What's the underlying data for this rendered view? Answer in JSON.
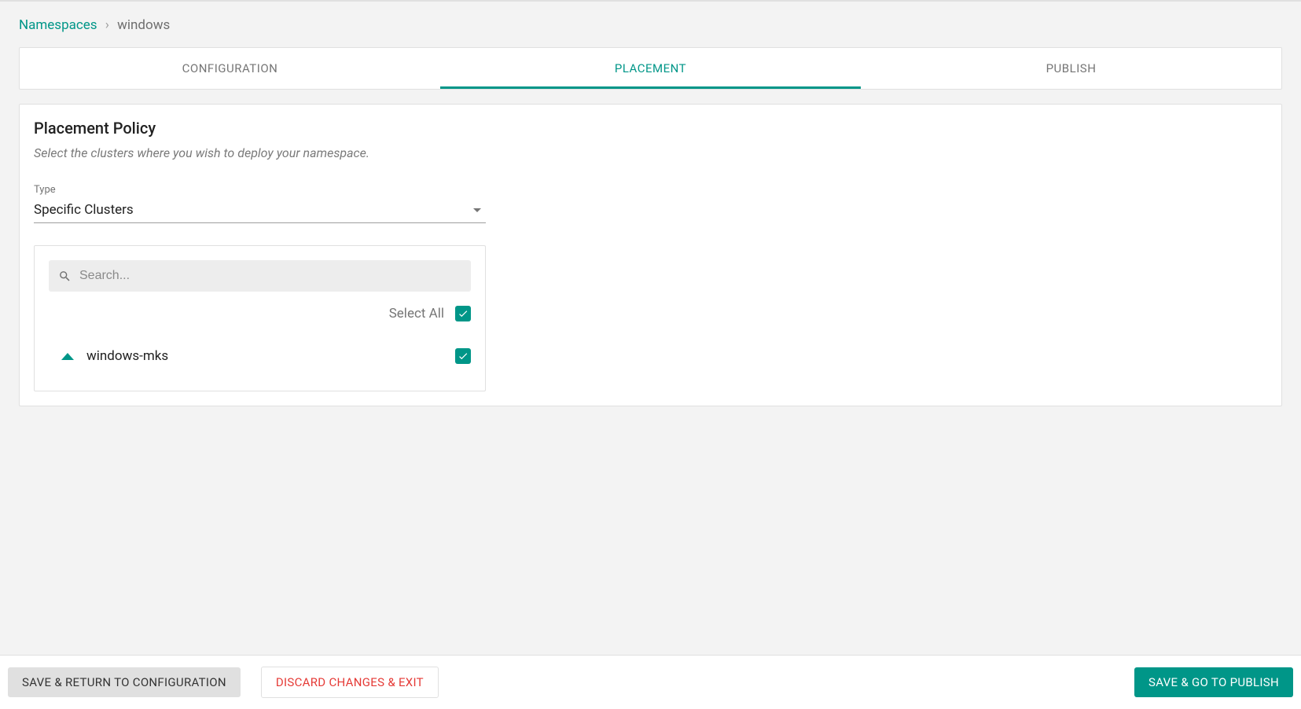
{
  "breadcrumb": {
    "root": "Namespaces",
    "current": "windows"
  },
  "tabs": {
    "configuration": "CONFIGURATION",
    "placement": "PLACEMENT",
    "publish": "PUBLISH",
    "active": "placement"
  },
  "placement": {
    "title": "Placement Policy",
    "subtitle": "Select the clusters where you wish to deploy your namespace.",
    "type_label": "Type",
    "type_value": "Specific Clusters",
    "search_placeholder": "Search...",
    "select_all_label": "Select All",
    "select_all_checked": true,
    "clusters": [
      {
        "name": "windows-mks",
        "checked": true,
        "expanded": true
      }
    ]
  },
  "footer": {
    "back": "SAVE & RETURN TO CONFIGURATION",
    "discard": "DISCARD CHANGES & EXIT",
    "next": "SAVE & GO TO PUBLISH"
  },
  "colors": {
    "accent": "#009688",
    "danger": "#e53935"
  }
}
